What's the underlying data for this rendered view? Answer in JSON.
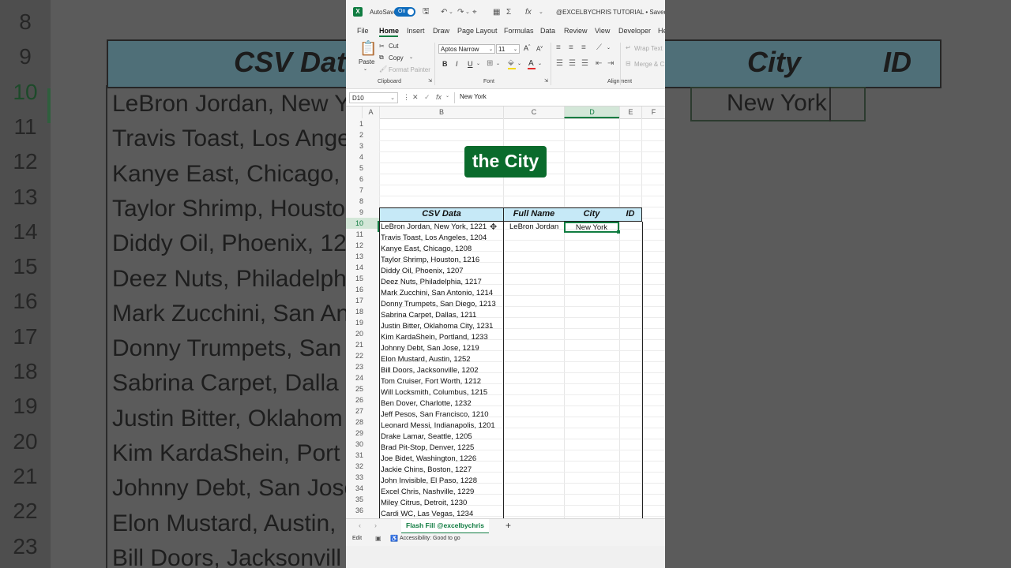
{
  "background": {
    "row_numbers": [
      "8",
      "9",
      "10",
      "11",
      "12",
      "13",
      "14",
      "15",
      "16",
      "17",
      "18",
      "19",
      "20",
      "21",
      "22",
      "23"
    ],
    "headers": [
      "CSV Dat",
      "City",
      "ID"
    ],
    "rows": [
      "LeBron Jordan, New Y",
      "Travis Toast, Los Ange",
      "Kanye East, Chicago,",
      "Taylor Shrimp, Housto",
      "Diddy Oil, Phoenix, 12",
      "Deez Nuts, Philadelph",
      "Mark Zucchini, San An",
      "Donny Trumpets, San",
      "Sabrina Carpet, Dalla",
      "Justin Bitter, Oklahom",
      "Kim KardaShein, Port",
      "Johnny Debt, San Jose",
      "Elon Mustard, Austin,",
      "Bill Doors, Jacksonvill"
    ],
    "city_value": "New York"
  },
  "titlebar": {
    "app_icon": "excel-logo",
    "autosave_label": "AutoSave",
    "autosave_state": "On",
    "doc_title": "@EXCELBYCHRIS TUTORIAL • Saved ⌄"
  },
  "tabs": [
    "File",
    "Home",
    "Insert",
    "Draw",
    "Page Layout",
    "Formulas",
    "Data",
    "Review",
    "View",
    "Developer",
    "He"
  ],
  "ribbon": {
    "paste": "Paste",
    "cut": "Cut",
    "copy": "Copy",
    "format_painter": "Format Painter",
    "clipboard_label": "Clipboard",
    "font_name": "Aptos Narrow",
    "font_size": "11",
    "bold": "B",
    "italic": "I",
    "underline": "U",
    "font_label": "Font",
    "wrap_text": "Wrap Text",
    "merge": "Merge & C",
    "alignment_label": "Alignment"
  },
  "formula_bar": {
    "name_box": "D10",
    "value": "New York"
  },
  "columns": [
    "A",
    "B",
    "C",
    "D",
    "E",
    "F"
  ],
  "row_numbers": [
    "1",
    "2",
    "3",
    "4",
    "5",
    "6",
    "7",
    "8",
    "9",
    "10",
    "11",
    "12",
    "13",
    "14",
    "15",
    "16",
    "17",
    "18",
    "19",
    "20",
    "21",
    "22",
    "23",
    "24",
    "25",
    "26",
    "27",
    "28",
    "29",
    "30",
    "31",
    "32",
    "33",
    "34",
    "35",
    "36"
  ],
  "table": {
    "headers": {
      "csv": "CSV Data",
      "full_name": "Full Name",
      "city": "City",
      "id": "ID"
    },
    "csv_rows": [
      "LeBron Jordan, New York, 1221",
      "Travis Toast, Los Angeles, 1204",
      "Kanye East, Chicago, 1208",
      "Taylor Shrimp, Houston, 1216",
      "Diddy Oil, Phoenix, 1207",
      "Deez Nuts, Philadelphia, 1217",
      "Mark Zucchini, San Antonio, 1214",
      "Donny Trumpets, San Diego, 1213",
      "Sabrina Carpet, Dallas, 1211",
      "Justin Bitter, Oklahoma City, 1231",
      "Kim KardaShein, Portland, 1233",
      "Johnny Debt, San Jose, 1219",
      "Elon Mustard, Austin, 1252",
      "Bill Doors, Jacksonville, 1202",
      "Tom Cruiser, Fort Worth, 1212",
      "Will Locksmith, Columbus, 1215",
      "Ben Dover, Charlotte, 1232",
      "Jeff Pesos, San Francisco, 1210",
      "Leonard Messi, Indianapolis, 1201",
      "Drake Lamar, Seattle, 1205",
      "Brad Pit-Stop, Denver, 1225",
      "Joe Bidet, Washington, 1226",
      "Jackie Chins, Boston, 1227",
      "John Invisible, El Paso, 1228",
      "Excel Chris, Nashville, 1229",
      "Miley Citrus, Detroit, 1230",
      "Cardi WC, Las Vegas, 1234"
    ],
    "full_name_first": "LeBron Jordan",
    "city_first": "New York"
  },
  "overlay_caption": "the City",
  "sheet_tab": "Flash Fill @excelbychris",
  "status": {
    "mode": "Edit",
    "accessibility": "Accessibility: Good to go"
  },
  "colors": {
    "excel_green": "#107c41",
    "header_fill": "#c6e9f7",
    "overlay_green": "#0a6b2c"
  }
}
